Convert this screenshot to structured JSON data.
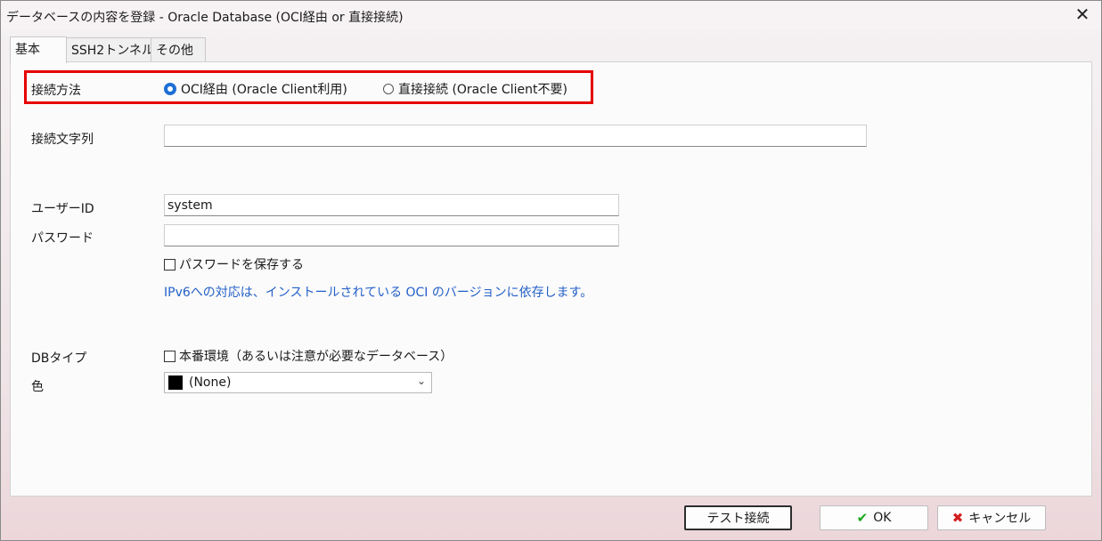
{
  "window": {
    "title": "データベースの内容を登録 - Oracle Database (OCI経由 or 直接接続)",
    "close_icon": "close-icon"
  },
  "tabs": [
    {
      "label": "基本"
    },
    {
      "label": "SSH2トンネル"
    },
    {
      "label": "その他"
    }
  ],
  "form": {
    "connection_method": {
      "label": "接続方法",
      "options": [
        {
          "label": "OCI経由 (Oracle Client利用)",
          "selected": true
        },
        {
          "label": "直接接続 (Oracle Client不要)",
          "selected": false
        }
      ]
    },
    "connection_string": {
      "label": "接続文字列",
      "value": ""
    },
    "user_id": {
      "label": "ユーザーID",
      "value": "system"
    },
    "password": {
      "label": "パスワード",
      "value": ""
    },
    "save_password": {
      "label": "パスワードを保存する",
      "checked": false
    },
    "ipv6_note": "IPv6への対応は、インストールされている OCI のバージョンに依存します。",
    "db_type": {
      "label": "DBタイプ",
      "production_label": "本番環境（あるいは注意が必要なデータベース）",
      "checked": false
    },
    "color": {
      "label": "色",
      "selected": "(None)",
      "swatch": "#000000"
    }
  },
  "buttons": {
    "test_connection": "テスト接続",
    "ok": "OK",
    "cancel": "キャンセル"
  },
  "colors": {
    "accent": "#1e6fd6",
    "highlight_border": "#e60000",
    "note_text": "#2460c8",
    "ok_icon": "#17a81a",
    "cancel_icon": "#d21e1e"
  }
}
